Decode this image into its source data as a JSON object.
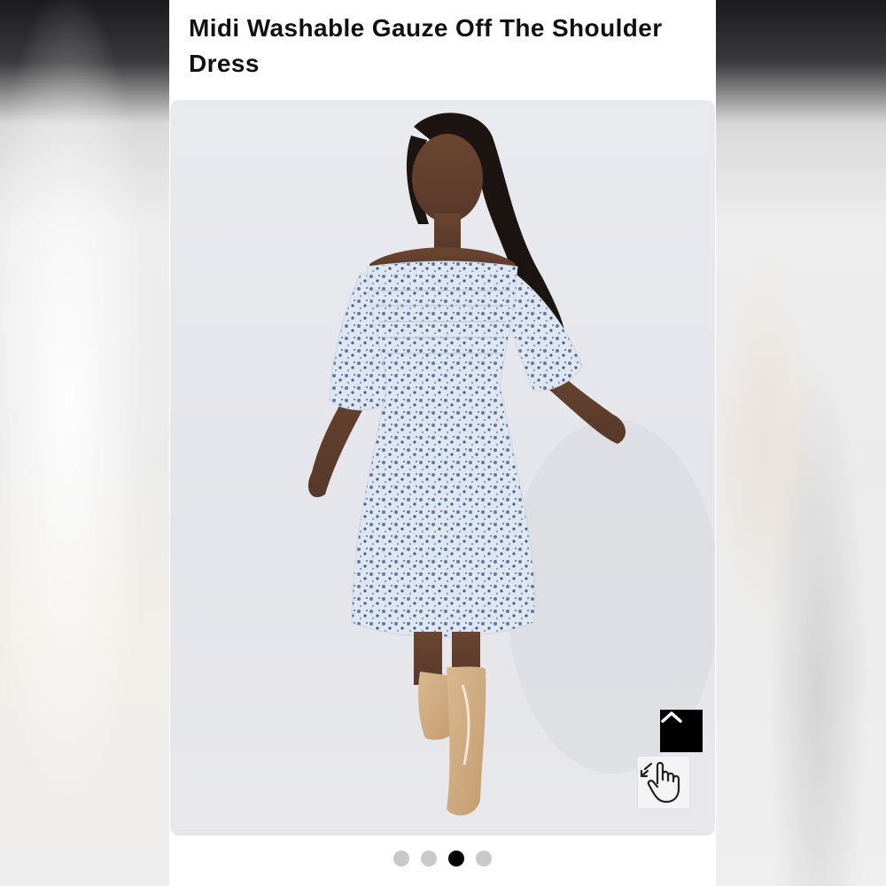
{
  "product": {
    "title": "Midi Washable Gauze Off The Shoulder Dress"
  },
  "gallery": {
    "active_index": 3,
    "total": 4
  },
  "controls": {
    "scroll_top_icon": "chevron-up-icon",
    "zoom_icon": "hand-pointer-icon"
  },
  "colors": {
    "accent": "#000000",
    "dot_inactive": "#c9c9c9"
  }
}
